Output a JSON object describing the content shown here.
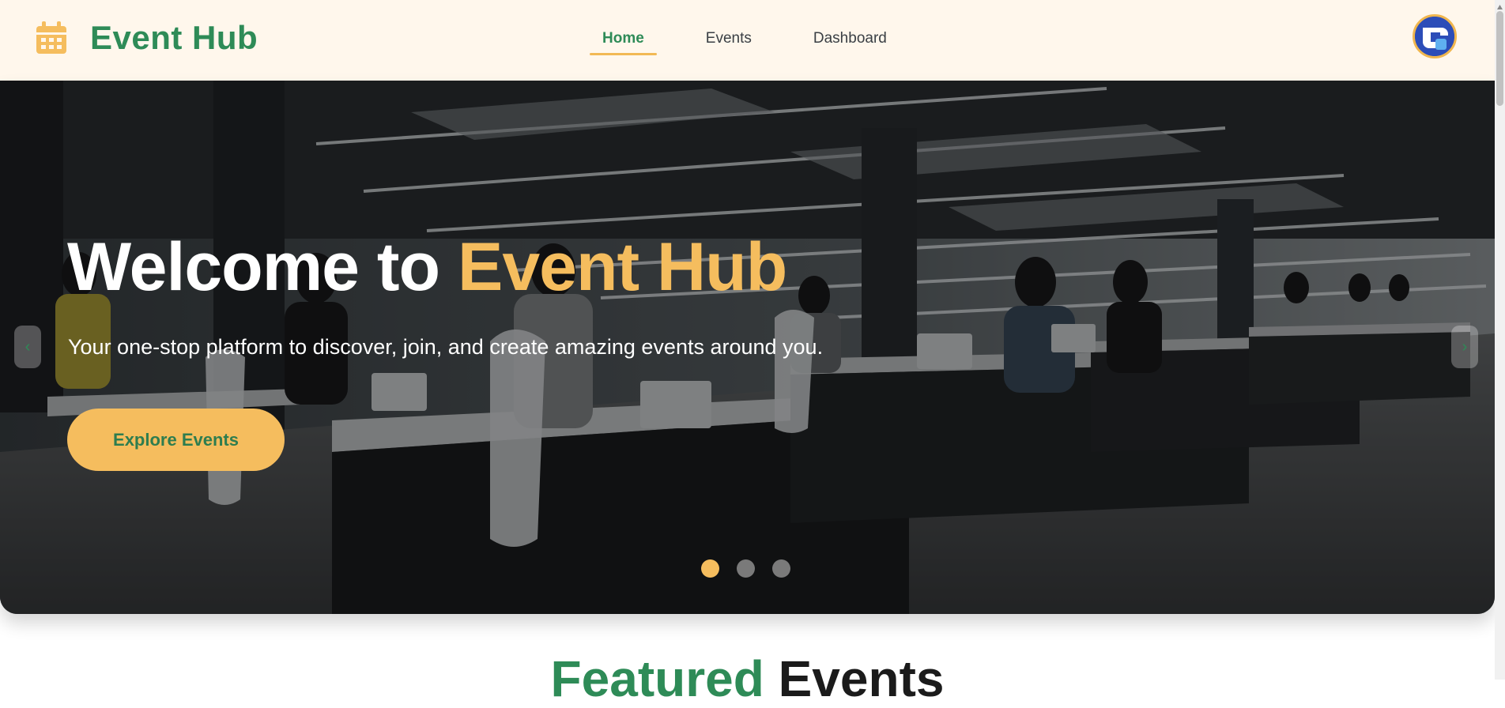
{
  "brand": {
    "name": "Event Hub",
    "icon": "calendar-icon",
    "icon_color": "#f5bd5e",
    "name_color": "#2e8b57"
  },
  "nav": {
    "items": [
      {
        "label": "Home",
        "active": true
      },
      {
        "label": "Events",
        "active": false
      },
      {
        "label": "Dashboard",
        "active": false
      }
    ]
  },
  "user": {
    "avatar_icon": "user-avatar-icon"
  },
  "hero": {
    "title_prefix": "Welcome to ",
    "title_accent": "Event Hub",
    "subtitle": "Your one-stop platform to discover, join, and create amazing events around you.",
    "cta_label": "Explore Events",
    "prev_icon": "chevron-left-icon",
    "next_icon": "chevron-right-icon",
    "prev_glyph": "‹",
    "next_glyph": "›",
    "slides_total": 3,
    "active_slide": 1
  },
  "featured": {
    "title_accent": "Featured",
    "title_rest": " Events"
  },
  "colors": {
    "accent": "#f5bd5e",
    "brand_green": "#2e8b57",
    "navbar_bg": "#fff7ec"
  }
}
